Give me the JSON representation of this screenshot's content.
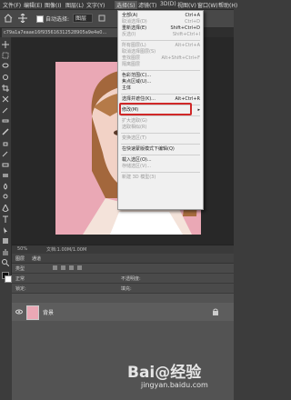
{
  "menubar": {
    "items": [
      "文件(F)",
      "编辑(E)",
      "图像(I)",
      "图层(L)",
      "文字(Y)",
      "选择(S)",
      "滤镜(T)",
      "3D(D)",
      "视图(V)",
      "窗口(W)",
      "帮助(H)"
    ],
    "active": "选择(S)"
  },
  "options": {
    "autoselect_label": "自动选择:",
    "target_value": "图层"
  },
  "document": {
    "tab": "c79a1a7eaae16f935616312528905a9e4e0..."
  },
  "status": {
    "zoom": "50%",
    "docinfo": "文档:1.00M/1.00M"
  },
  "panel": {
    "tab1": "图层",
    "tab2": "通道",
    "kind_label": "类型",
    "blend_label": "正常",
    "opacity_label": "不透明度:",
    "lock_label": "锁定:",
    "fill_label": "填充:",
    "layer_name": "背景"
  },
  "menu": {
    "items": [
      {
        "label": "全部(A)",
        "shortcut": "Ctrl+A",
        "disabled": false
      },
      {
        "label": "取消选择(D)",
        "shortcut": "Ctrl+D",
        "disabled": true
      },
      {
        "label": "重新选择(E)",
        "shortcut": "Shift+Ctrl+D",
        "disabled": false
      },
      {
        "label": "反选(I)",
        "shortcut": "Shift+Ctrl+I",
        "disabled": true
      },
      {
        "label": "所有图层(L)",
        "shortcut": "Alt+Ctrl+A",
        "disabled": true
      },
      {
        "label": "取消选择图层(S)",
        "shortcut": "",
        "disabled": true
      },
      {
        "label": "查找图层",
        "shortcut": "Alt+Shift+Ctrl+F",
        "disabled": true
      },
      {
        "label": "隔离图层",
        "shortcut": "",
        "disabled": true
      },
      {
        "label": "色彩范围(C)...",
        "shortcut": "",
        "disabled": false
      },
      {
        "label": "焦点区域(U)...",
        "shortcut": "",
        "disabled": false
      },
      {
        "label": "主体",
        "shortcut": "",
        "disabled": false
      },
      {
        "label": "选择并遮住(K)...",
        "shortcut": "Alt+Ctrl+R",
        "disabled": false
      },
      {
        "label": "修改(M)",
        "shortcut": "▸",
        "disabled": false
      },
      {
        "label": "扩大选取(G)",
        "shortcut": "",
        "disabled": true
      },
      {
        "label": "选取相似(R)",
        "shortcut": "",
        "disabled": true
      },
      {
        "label": "变换选区(T)",
        "shortcut": "",
        "disabled": true
      },
      {
        "label": "在快速蒙版模式下编辑(Q)",
        "shortcut": "",
        "disabled": false
      },
      {
        "label": "载入选区(O)...",
        "shortcut": "",
        "disabled": false
      },
      {
        "label": "存储选区(V)...",
        "shortcut": "",
        "disabled": true
      },
      {
        "label": "新建 3D 模型(3)",
        "shortcut": "",
        "disabled": true
      }
    ],
    "highlighted": "主体"
  },
  "watermark": {
    "brand": "Bai@经验",
    "url": "jingyan.baidu.com"
  },
  "colors": {
    "highlight": "#d02828",
    "photo_bg": "#eaa8b5"
  }
}
